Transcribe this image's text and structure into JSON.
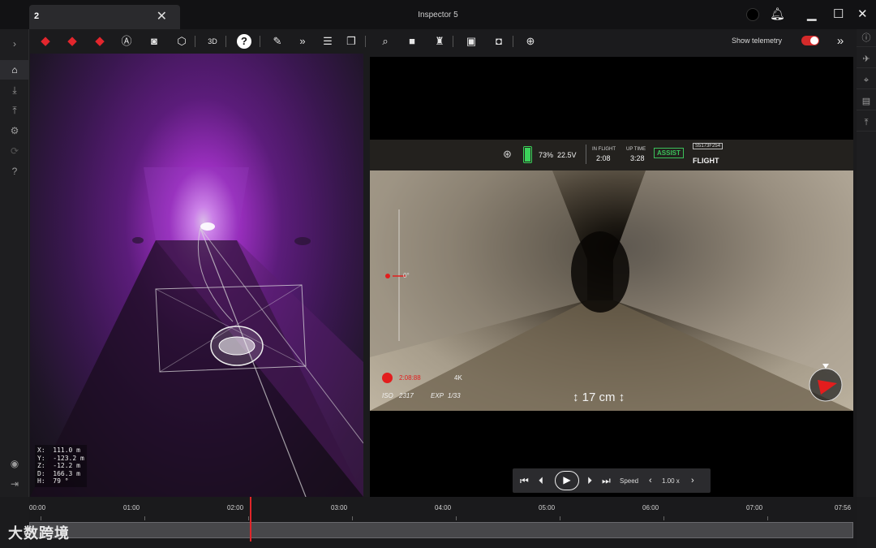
{
  "window": {
    "tab_label": "2",
    "title": "Inspector 5"
  },
  "toolbar": {
    "show_telemetry_label": "Show telemetry",
    "show_telemetry_on": true
  },
  "viewport": {
    "coords": [
      {
        "label": "X:",
        "value": "111.0 m"
      },
      {
        "label": "Y:",
        "value": "-123.2 m"
      },
      {
        "label": "Z:",
        "value": "-12.2 m"
      },
      {
        "label": "D:",
        "value": "166.3 m"
      },
      {
        "label": "H:",
        "value": "79 °"
      }
    ]
  },
  "hud": {
    "battery_pct": "73%",
    "battery_level": 0.73,
    "voltage": "22.5V",
    "in_flight_label": "IN FLIGHT",
    "in_flight_time": "2:08",
    "up_time_label": "UP TIME",
    "up_time": "3:28",
    "assist_label": "ASSIST",
    "serial": "S5173F254",
    "mode": "FLIGHT",
    "tilt_value": "0°",
    "resolution": "4K",
    "rec_time": "2:08:88",
    "iso_label": "ISO",
    "iso_value": "2317",
    "exp_label": "EXP",
    "exp_value": "1/33",
    "distance": "17 cm"
  },
  "playback": {
    "speed_label": "Speed",
    "speed_value": "1.00 x"
  },
  "timeline": {
    "labels": [
      "00:00",
      "01:00",
      "02:00",
      "03:00",
      "04:00",
      "05:00",
      "06:00",
      "07:00",
      "07:56"
    ],
    "playhead_time": "02:08"
  },
  "watermark": "大数跨境",
  "colors": {
    "accent_red": "#e3262d",
    "assist_green": "#3bc15a",
    "viewport_purple": "#9b2fc0"
  }
}
